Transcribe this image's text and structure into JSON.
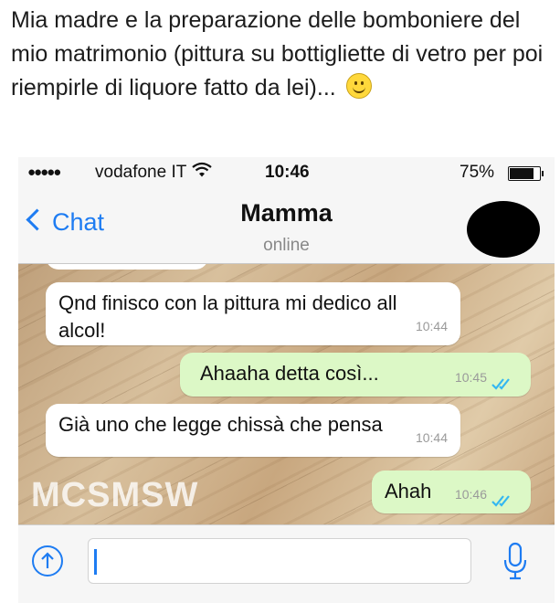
{
  "post": {
    "caption": "Mia madre e la preparazione delle bomboniere del mio matrimonio (pittura su bottigliette di vetro per poi riempirle di liquore fatto da lei)..."
  },
  "statusbar": {
    "signal": "●●●●●",
    "carrier": "vodafone IT",
    "time": "10:46",
    "battery_percent": "75%",
    "battery_level": 0.75
  },
  "header": {
    "back_label": "Chat",
    "contact_name": "Mamma",
    "contact_status": "online"
  },
  "messages": [
    {
      "direction": "in",
      "text": "Qnd finisco con la pittura mi dedico all alcol!",
      "time": "10:44"
    },
    {
      "direction": "out",
      "text": "Ahaaha detta così...",
      "time": "10:45",
      "read": true
    },
    {
      "direction": "in",
      "text": "Già uno che legge chissà che pensa",
      "time": "10:44"
    },
    {
      "direction": "out",
      "text": "Ahah",
      "time": "10:46",
      "read": true
    }
  ],
  "watermark": "MCSMSW",
  "colors": {
    "accent": "#1e7cf2",
    "outgoing_bubble": "#dcf8c6",
    "incoming_bubble": "#ffffff",
    "read_ticks": "#34b7f1"
  },
  "icons": {
    "emoji": "smiley-face-icon",
    "wifi": "wifi-icon",
    "back": "chevron-left-icon",
    "upload": "upload-arrow-icon",
    "mic": "microphone-icon",
    "read": "double-check-icon"
  }
}
